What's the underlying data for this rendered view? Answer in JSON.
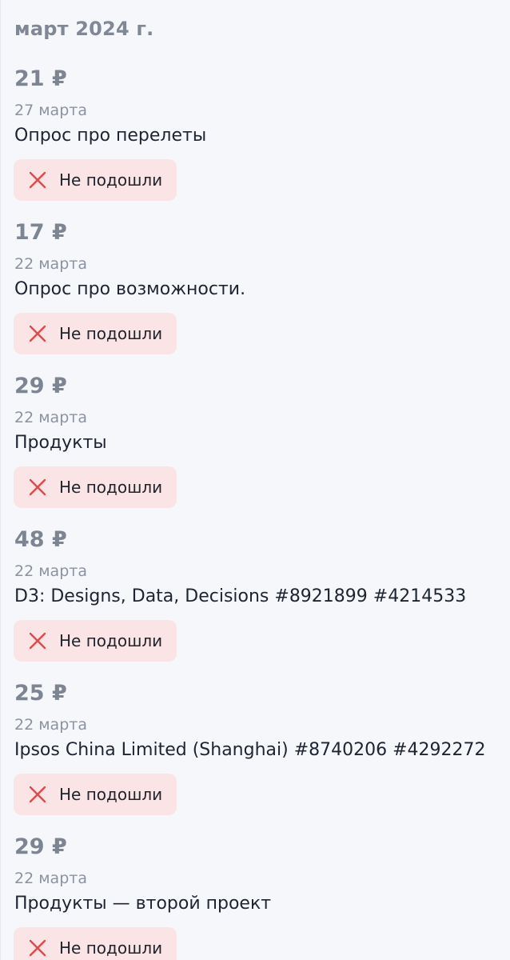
{
  "month_label": "март 2024 г.",
  "colors": {
    "background": "#f5f7fb",
    "status_bg": "#fbe4e6",
    "status_icon": "#e24848"
  },
  "items": [
    {
      "amount": "21 ₽",
      "date": "27 марта",
      "title": "Опрос про перелеты",
      "status": "Не подошли",
      "status_icon": "close-icon"
    },
    {
      "amount": "17 ₽",
      "date": "22 марта",
      "title": "Опрос про возможности.",
      "status": "Не подошли",
      "status_icon": "close-icon"
    },
    {
      "amount": "29 ₽",
      "date": "22 марта",
      "title": "Продукты",
      "status": "Не подошли",
      "status_icon": "close-icon"
    },
    {
      "amount": "48 ₽",
      "date": "22 марта",
      "title": "D3: Designs, Data, Decisions #8921899 #4214533",
      "status": "Не подошли",
      "status_icon": "close-icon"
    },
    {
      "amount": "25 ₽",
      "date": "22 марта",
      "title": "Ipsos China Limited (Shanghai) #8740206 #4292272",
      "status": "Не подошли",
      "status_icon": "close-icon"
    },
    {
      "amount": "29 ₽",
      "date": "22 марта",
      "title": "Продукты — второй проект",
      "status": "Не подошли",
      "status_icon": "close-icon"
    }
  ]
}
